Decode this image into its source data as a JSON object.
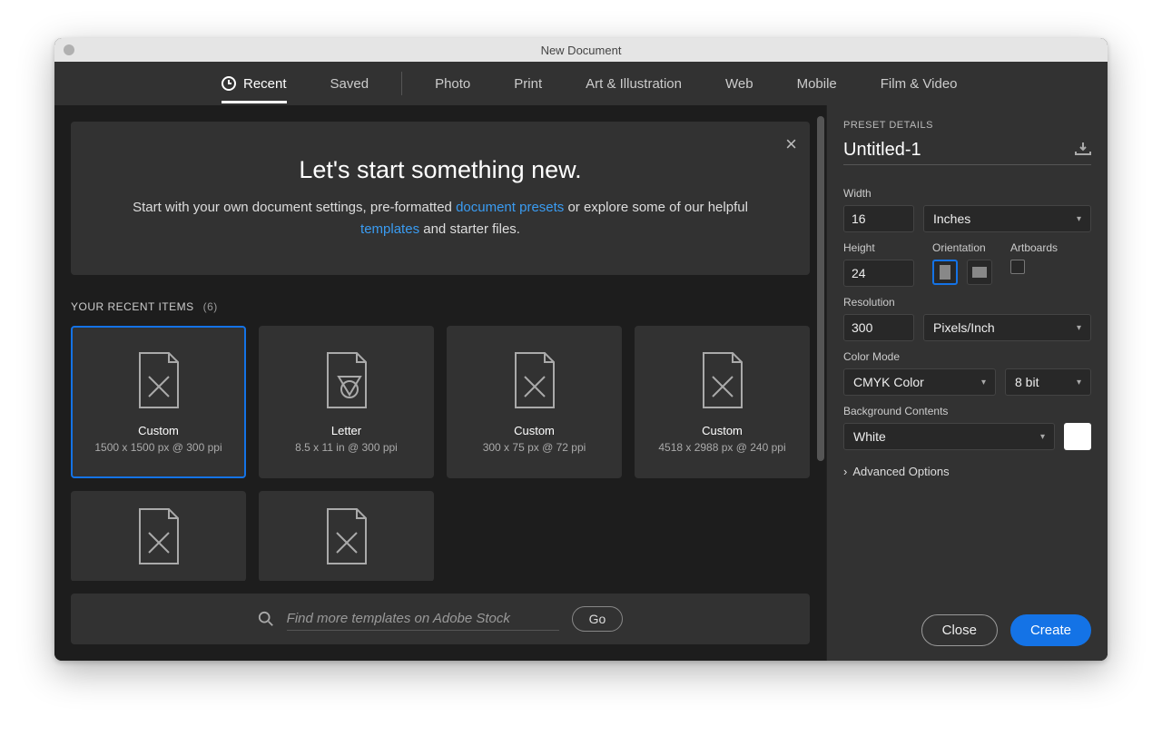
{
  "window": {
    "title": "New Document"
  },
  "tabs": {
    "recent": "Recent",
    "saved": "Saved",
    "photo": "Photo",
    "print": "Print",
    "art": "Art & Illustration",
    "web": "Web",
    "mobile": "Mobile",
    "film": "Film & Video"
  },
  "banner": {
    "title": "Let's start something new.",
    "line1_a": "Start with your own document settings, pre-formatted ",
    "link1": "document presets",
    "line1_b": " or explore some of our helpful ",
    "link2": "templates",
    "line1_c": " and starter files."
  },
  "section": {
    "label": "YOUR RECENT ITEMS",
    "count": "(6)"
  },
  "cards": [
    {
      "label": "Custom",
      "sub": "1500 x 1500 px @ 300 ppi"
    },
    {
      "label": "Letter",
      "sub": "8.5 x 11 in @ 300 ppi"
    },
    {
      "label": "Custom",
      "sub": "300 x 75 px @ 72 ppi"
    },
    {
      "label": "Custom",
      "sub": "4518 x 2988 px @ 240 ppi"
    },
    {
      "label": "",
      "sub": ""
    },
    {
      "label": "",
      "sub": ""
    }
  ],
  "search": {
    "placeholder": "Find more templates on Adobe Stock",
    "go": "Go"
  },
  "panel": {
    "title": "PRESET DETAILS",
    "doc_name": "Untitled-1",
    "width_label": "Width",
    "width_value": "16",
    "width_unit": "Inches",
    "height_label": "Height",
    "height_value": "24",
    "orientation_label": "Orientation",
    "artboards_label": "Artboards",
    "resolution_label": "Resolution",
    "resolution_value": "300",
    "resolution_unit": "Pixels/Inch",
    "colormode_label": "Color Mode",
    "colormode_value": "CMYK Color",
    "bitdepth_value": "8 bit",
    "bgcontents_label": "Background Contents",
    "bgcontents_value": "White",
    "advanced": "Advanced Options"
  },
  "footer": {
    "close": "Close",
    "create": "Create"
  }
}
